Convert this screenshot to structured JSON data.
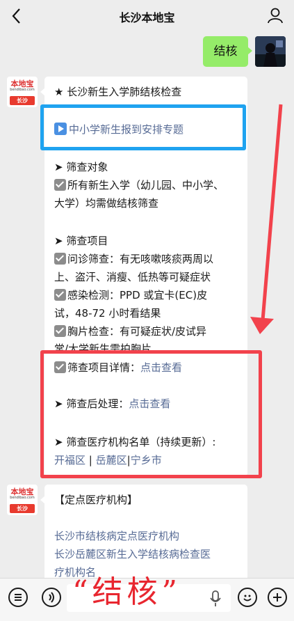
{
  "header": {
    "title": "长沙本地宝"
  },
  "sent_message": {
    "text": "结核"
  },
  "bot": {
    "brand": "本地宝",
    "site": "bendibao.com",
    "city": "长沙"
  },
  "message1": {
    "heading": "★ 长沙新生入学肺结核检查",
    "special_link": "中小学新生报到安排专题",
    "target_title": "➤ 筛查对象",
    "target_line1": "所有新生入学（幼儿园、中小学、",
    "target_line2": "大学）均需做结核筛查",
    "items_title": "➤ 筛查项目",
    "item1_line1": "问诊筛查：有无咳嗽咳痰两周以",
    "item1_line2": "上、盗汗、消瘦、低热等可疑症状",
    "item2_line1": "感染检测：PPD 或宜卡(EC)皮",
    "item2_line2": "试，48-72 小时看结果",
    "item3_line1": "胸片检查：有可疑症状/皮试异",
    "item3_line2": "常/大学新生需拍胸片",
    "details_label": "筛查项目详情：",
    "details_link": "点击查看",
    "after_label": "➤ 筛查后处理：",
    "after_link": "点击查看",
    "hospitals_label": "➤ 筛查医疗机构名单（持续更新）:",
    "district1": "开福区",
    "district2": "岳麓区",
    "district3": "宁乡市",
    "separator": "|"
  },
  "message2": {
    "heading": "【定点医疗机构】",
    "link1": "长沙市结核病定点医疗机构",
    "link2_line1": "长沙岳麓区新生入学结核病检查医",
    "link2_line2": "疗机构名"
  },
  "overlay": {
    "text": "“结核”"
  },
  "colors": {
    "link": "#576b95",
    "sent_bubble": "#95ec69",
    "blue_box": "#1fa3f0",
    "red_box": "#f2424c"
  }
}
